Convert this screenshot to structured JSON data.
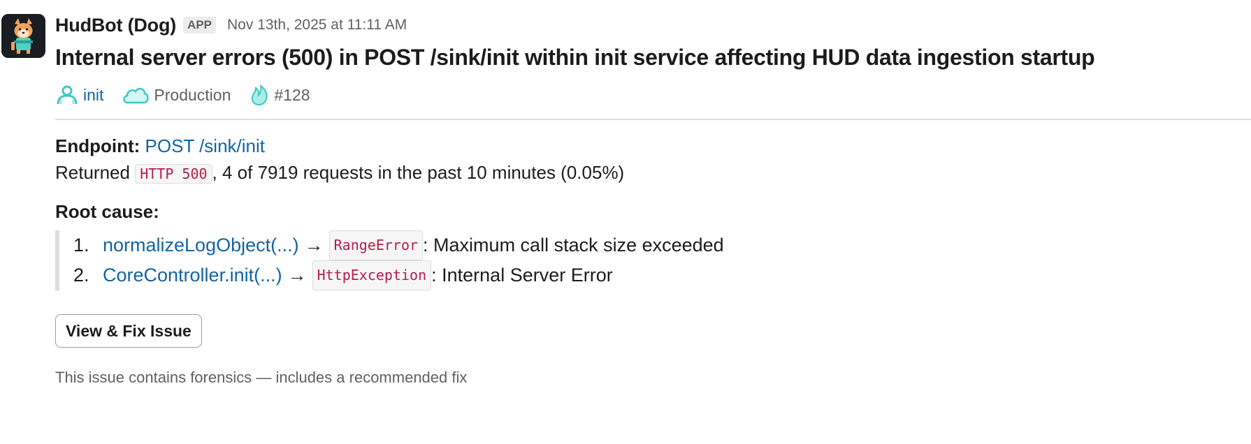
{
  "bot": {
    "name": "HudBot (Dog)",
    "badge": "APP",
    "timestamp": "Nov 13th, 2025 at 11:11 AM",
    "avatar_icon": "shiba-dog-icon"
  },
  "title": "Internal server errors (500) in POST /sink/init within init service affecting HUD data ingestion startup",
  "tags": [
    {
      "icon": "service-users-icon",
      "label": "init"
    },
    {
      "icon": "cloud-icon",
      "label": "Production"
    },
    {
      "icon": "flame-icon",
      "label": "#128"
    }
  ],
  "endpoint": {
    "label": "Endpoint:",
    "value": "POST /sink/init"
  },
  "returned": {
    "prefix": "Returned",
    "code": "HTTP 500",
    "suffix": ", 4 of 7919 requests in the past 10 minutes (0.05%)"
  },
  "root_cause": {
    "label": "Root cause:",
    "items": [
      {
        "num": "1.",
        "func": "normalizeLogObject(...)",
        "arrow": "→",
        "error": "RangeError",
        "message": ": Maximum call stack size exceeded"
      },
      {
        "num": "2.",
        "func": "CoreController.init(...)",
        "arrow": "→",
        "error": "HttpException",
        "message": ": Internal Server Error"
      }
    ]
  },
  "button": {
    "label": "View & Fix Issue"
  },
  "footer": "This issue contains forensics — includes a recommended fix",
  "colors": {
    "link": "#1264a3",
    "code": "#b41e47",
    "icon_teal": "#3cc9c4"
  }
}
